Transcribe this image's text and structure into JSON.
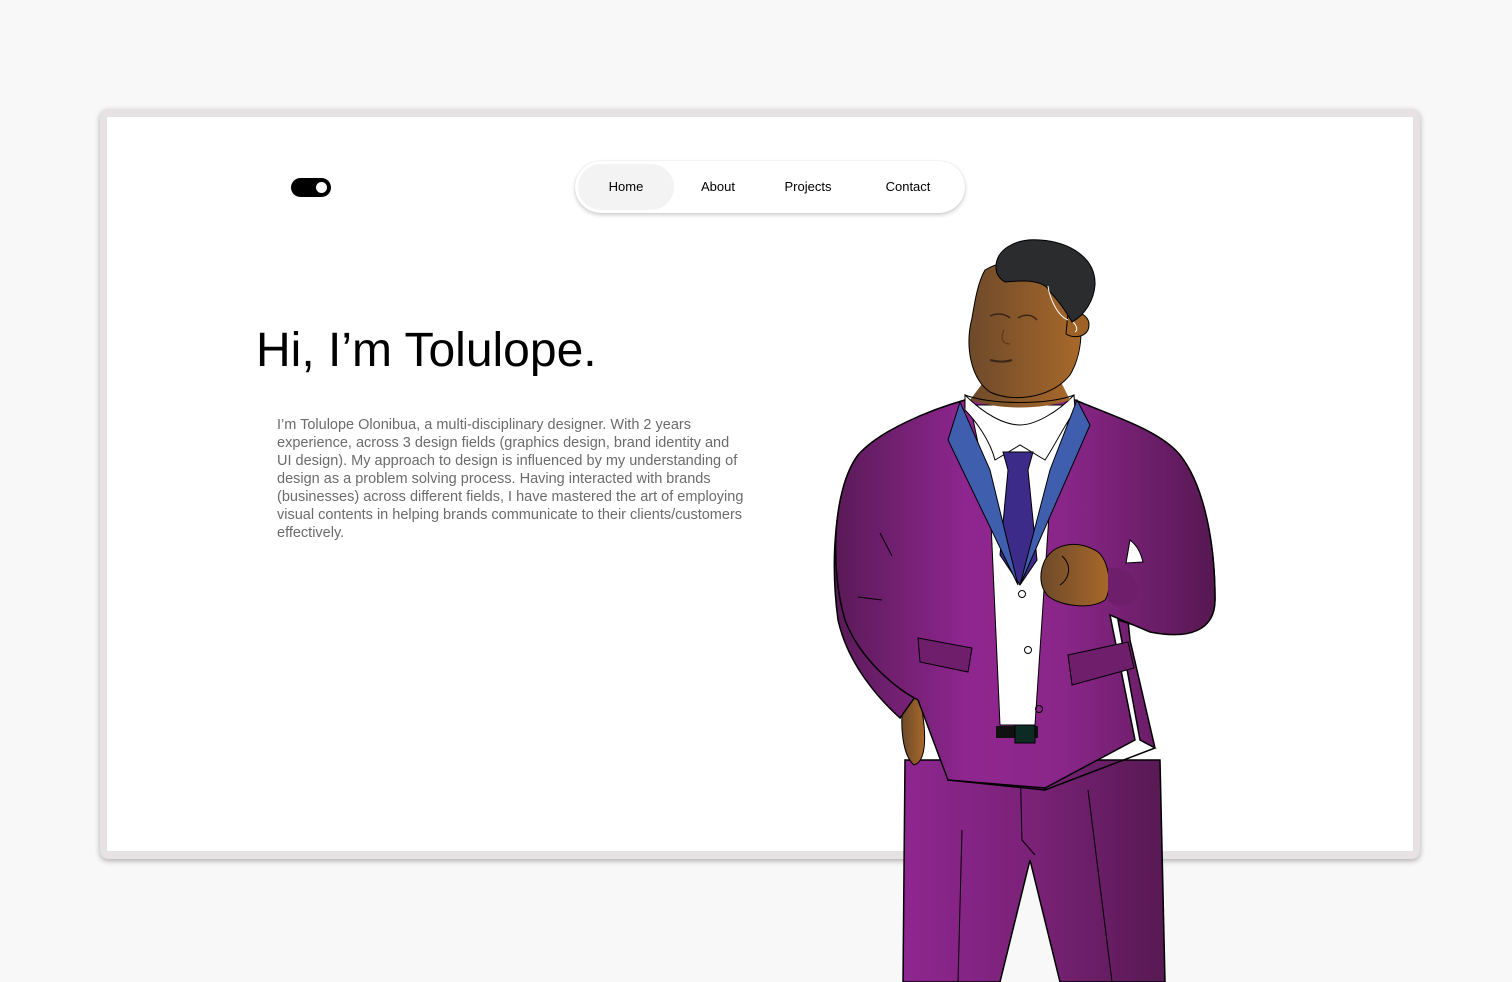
{
  "theme_toggle": {
    "state": "on"
  },
  "nav": {
    "items": [
      {
        "label": "Home",
        "active": true
      },
      {
        "label": "About",
        "active": false
      },
      {
        "label": "Projects",
        "active": false
      },
      {
        "label": "Contact",
        "active": false
      }
    ]
  },
  "hero": {
    "title": "Hi, I’m Tolulope.",
    "bio": "I’m Tolulope Olonibua, a multi-disciplinary designer. With  2 years experience, across 3 design fields (graphics design, brand identity and UI design). My approach to design is influenced by my understanding of design as a problem solving  process. Having interacted with brands (businesses) across different fields, I have mastered the art of employing visual contents in helping brands communicate to their clients/customers effectively."
  },
  "colors": {
    "suit": "#8a2689",
    "suit_dark": "#5a1a58",
    "lapel": "#3f5fae",
    "tie": "#3d2b8a",
    "skin": "#8a6330",
    "hair": "#2a2c2e",
    "accent": "#000000"
  }
}
